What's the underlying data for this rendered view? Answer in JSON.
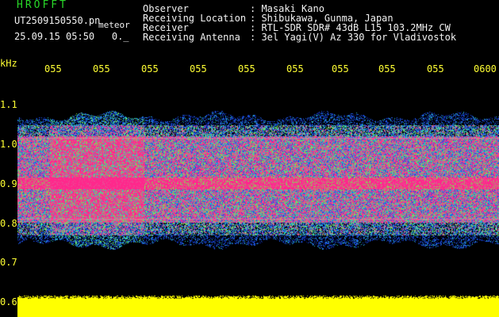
{
  "header": {
    "program": "HROFFT",
    "filename": "UT2509150550.pn",
    "tag": "meteor",
    "datetime": "25.09.15 05:50",
    "counter": "0._",
    "fields": [
      {
        "label": "Observer",
        "value": ": Masaki Kano"
      },
      {
        "label": "Receiving Location",
        "value": ": Shibukawa, Gunma, Japan"
      },
      {
        "label": "Receiver",
        "value": ": RTL-SDR SDR# 43dB L15 103.2MHz CW"
      },
      {
        "label": "Receiving Antenna",
        "value": ": 3el Yagi(V) Az 330 for Vladivostok"
      }
    ]
  },
  "axis": {
    "unit": "kHz",
    "time_ticks": [
      "055",
      "055",
      "055",
      "055",
      "055",
      "055",
      "055",
      "055",
      "055",
      "0600"
    ],
    "freq_ticks": [
      "1.1",
      "1.0",
      "0.9",
      "0.8",
      "0.7",
      "0.6"
    ]
  },
  "colors": {
    "background": "#000000",
    "axis_text": "#ffff33",
    "title": "#28d728",
    "header_text": "#f2f2f2",
    "signal_peak": "#ff2f8a",
    "amplitude_bar": "#ffff00"
  }
}
